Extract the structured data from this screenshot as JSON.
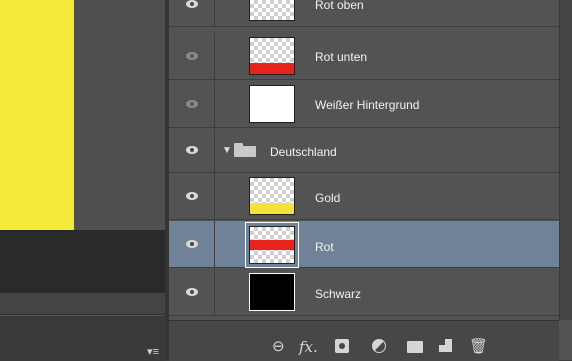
{
  "layers": [
    {
      "name": "Rot oben",
      "visibility": "visible",
      "thumb": "checker-red-top"
    },
    {
      "name": "Rot unten",
      "visibility": "dimmed",
      "thumb": "checker-red-bottom"
    },
    {
      "name": "Weißer Hintergrund",
      "visibility": "dimmed",
      "thumb": "white"
    },
    {
      "name": "Deutschland",
      "visibility": "visible",
      "type": "group",
      "expanded": true
    },
    {
      "name": "Gold",
      "visibility": "visible",
      "thumb": "checker-gold-bottom"
    },
    {
      "name": "Rot",
      "visibility": "visible",
      "thumb": "checker-red-middle",
      "selected": true
    },
    {
      "name": "Schwarz",
      "visibility": "visible",
      "thumb": "black"
    }
  ],
  "colors": {
    "canvas_yellow": "#f5e93a",
    "red_band": "#e8231b",
    "gold_band": "#f4e23a",
    "selection": "#6f8297"
  },
  "icons": {
    "bottom_bar": [
      "link-icon",
      "fx-icon",
      "layer-mask-icon",
      "adjustment-icon",
      "group-folder-icon",
      "new-layer-icon",
      "trash-icon"
    ],
    "status_menu": "panel-menu-icon"
  },
  "panel_buttons": {
    "link": "⊖",
    "fx": "fx.",
    "trash": "🗑"
  },
  "status_menu_glyph": "▾≡"
}
